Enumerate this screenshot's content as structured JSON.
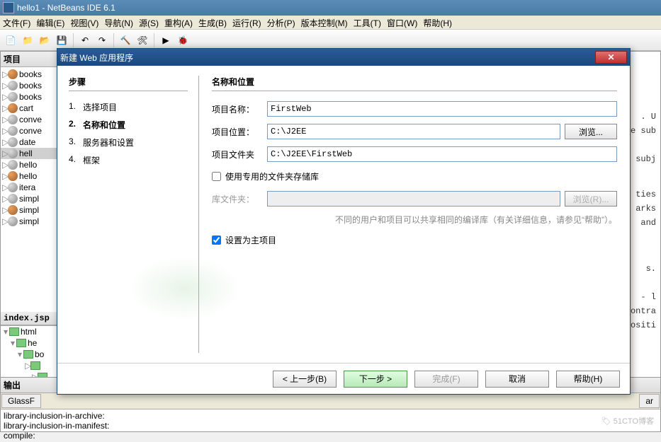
{
  "window": {
    "title": "hello1 - NetBeans IDE 6.1"
  },
  "menu": [
    "文件(F)",
    "编辑(E)",
    "视图(V)",
    "导航(N)",
    "源(S)",
    "重构(A)",
    "生成(B)",
    "运行(R)",
    "分析(P)",
    "版本控制(M)",
    "工具(T)",
    "窗口(W)",
    "帮助(H)"
  ],
  "projects": {
    "title": "项目",
    "items": [
      {
        "label": "books",
        "icon": "coffee"
      },
      {
        "label": "books",
        "icon": "grey"
      },
      {
        "label": "books",
        "icon": "grey"
      },
      {
        "label": "cart",
        "icon": "coffee"
      },
      {
        "label": "conve",
        "icon": "grey"
      },
      {
        "label": "conve",
        "icon": "grey"
      },
      {
        "label": "date",
        "icon": "grey"
      },
      {
        "label": "hell",
        "icon": "grey",
        "sel": true
      },
      {
        "label": "hello",
        "icon": "grey"
      },
      {
        "label": "hello",
        "icon": "coffee"
      },
      {
        "label": "itera",
        "icon": "grey"
      },
      {
        "label": "simpl",
        "icon": "grey"
      },
      {
        "label": "simpl",
        "icon": "coffee"
      },
      {
        "label": "simpl",
        "icon": "grey"
      }
    ],
    "jsp_title": "index.jsp",
    "jsp_items": [
      "html",
      "he",
      "bo",
      "",
      "",
      ""
    ]
  },
  "editor_fragments": [
    ". U",
    "e sub",
    "subj",
    "ties",
    "arks",
    "and",
    "s.",
    "- l",
    "ontra",
    "ositi"
  ],
  "output": {
    "title": "输出",
    "tab": "GlassF",
    "lines": [
      "library-inclusion-in-archive:",
      "library-inclusion-in-manifest:",
      "compile:"
    ]
  },
  "dialog": {
    "title": "新建 Web 应用程序",
    "steps_header": "步骤",
    "steps": [
      "选择项目",
      "名称和位置",
      "服务器和设置",
      "框架"
    ],
    "current_step_index": 1,
    "section": "名称和位置",
    "fields": {
      "name_label": "项目名称：",
      "name_value": "FirstWeb",
      "loc_label": "项目位置：",
      "loc_value": "C:\\J2EE",
      "folder_label": "项目文件夹",
      "folder_value": "C:\\J2EE\\FirstWeb",
      "lib_label": "库文件夹：",
      "browse": "浏览...",
      "browse2": "浏览(R)..."
    },
    "checks": {
      "dedicated": "使用专用的文件夹存储库",
      "main": "设置为主项目"
    },
    "hint": "不同的用户和项目可以共享相同的编译库（有关详细信息，请参见“帮助”）。",
    "buttons": {
      "prev": "< 上一步(B)",
      "next": "下一步 >",
      "finish": "完成(F)",
      "cancel": "取消",
      "help": "帮助(H)"
    }
  },
  "watermark": "🏷 51CTO博客",
  "extra_tab": "ar"
}
